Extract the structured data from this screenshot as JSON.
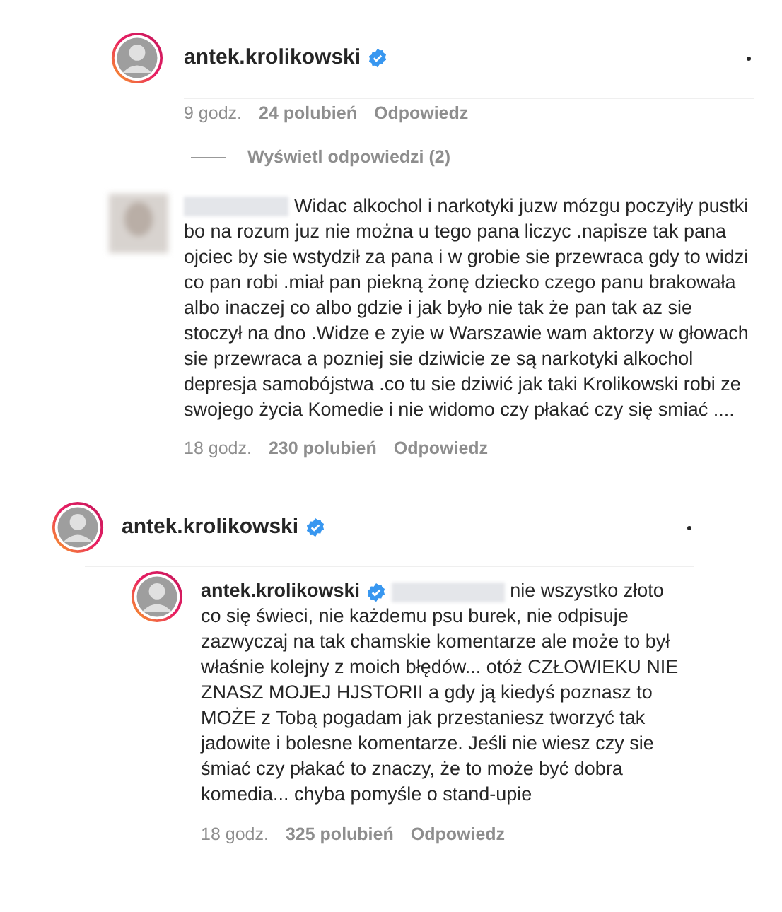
{
  "header": {
    "username": "antek.krolikowski",
    "verified": true
  },
  "top_meta": {
    "time": "9 godz.",
    "likes": "24 polubień",
    "reply": "Odpowiedz"
  },
  "view_replies": "Wyświetl odpowiedzi (2)",
  "comment": {
    "text": "Widac alkochol i narkotyki juzw mózgu poczyiły pustki bo na rozum juz nie można u tego pana liczyc .napisze tak pana ojciec by sie wstydził za pana i w grobie sie przewraca gdy to widzi co pan robi .miał pan piekną żonę dziecko czego panu brakowała albo inaczej co albo gdzie i jak było nie tak że pan tak az sie stoczył na dno .Widze e zyie w Warszawie wam aktorzy w głowach sie przewraca a pozniej sie dziwicie ze są narkotyki alkochol depresja samobójstwa .co tu sie dziwić jak taki Krolikowski robi ze swojego życia Komedie i nie widomo czy płakać czy się smiać ....",
    "time": "18 godz.",
    "likes": "230 polubień",
    "reply": "Odpowiedz"
  },
  "header2": {
    "username": "antek.krolikowski",
    "verified": true
  },
  "reply": {
    "username": "antek.krolikowski",
    "verified": true,
    "text": "nie wszystko złoto co się świeci, nie każdemu psu burek, nie odpisuje zazwyczaj na tak chamskie komentarze ale może to był właśnie kolejny z moich błędów... otóż CZŁOWIEKU NIE ZNASZ MOJEJ HJSTORII a gdy ją kiedyś poznasz to MOŻE z Tobą pogadam jak przestaniesz tworzyć tak jadowite i bolesne komentarze. Jeśli nie wiesz czy sie śmiać czy płakać to znaczy, że to może być dobra komedia... chyba pomyśle o stand-upie",
    "time": "18 godz.",
    "likes": "325 polubień",
    "reply": "Odpowiedz"
  }
}
